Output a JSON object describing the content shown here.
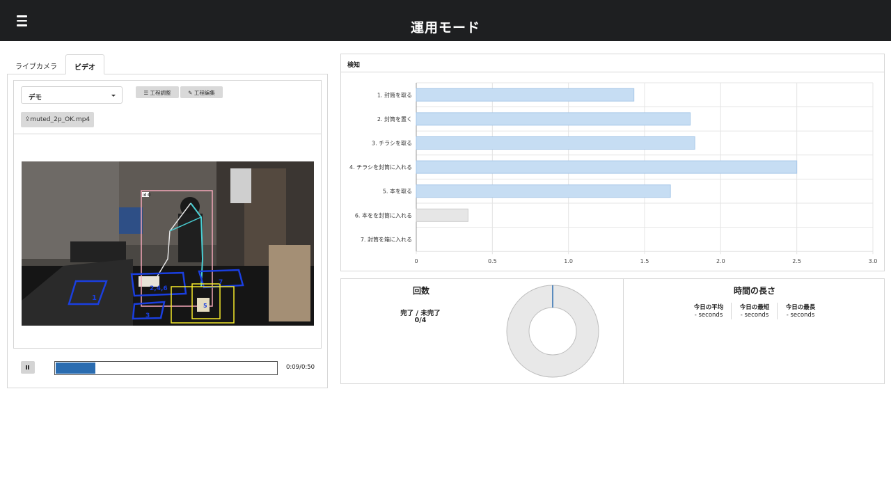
{
  "header": {
    "title": "運用モード",
    "menu_icon": "hamburger-menu-icon"
  },
  "tabs": [
    {
      "label": "ライブカメラ",
      "active": false
    },
    {
      "label": "ビデオ",
      "active": true
    }
  ],
  "video_panel": {
    "select_value": "デモ",
    "adjust_button": "工程調整",
    "edit_button": "工程編集",
    "file_button": "muted_2p_OK.mp4",
    "playback": {
      "time": "0:09/0:50",
      "progress": 0.18,
      "state": "playing"
    },
    "overlay_labels": [
      "id:0",
      "1",
      "2,4,6",
      "7",
      "3",
      "5"
    ]
  },
  "detection": {
    "title": "検知",
    "colors": {
      "bar_fill": "#c6ddf3",
      "bar_stroke": "#a7c7e8",
      "inactive_fill": "#e6e6e6",
      "inactive_stroke": "#cccccc"
    }
  },
  "chart_data": {
    "type": "bar",
    "orientation": "horizontal",
    "categories": [
      "1. 封筒を取る",
      "2. 封筒を置く",
      "3. チラシを取る",
      "4. チラシを封筒に入れる",
      "5. 本を取る",
      "6. 本をを封筒に入れる",
      "7. 封筒を箱に入れる"
    ],
    "values": [
      1.43,
      1.8,
      1.83,
      2.5,
      1.67,
      0.34,
      0
    ],
    "highlighted": [
      true,
      true,
      true,
      true,
      true,
      false,
      false
    ],
    "xlim": [
      0,
      3.0
    ],
    "xticks": [
      "0",
      "0.5",
      "1.0",
      "1.5",
      "2.0",
      "2.5",
      "3.0"
    ],
    "grid": true
  },
  "count": {
    "title": "回数",
    "label": "完了 / 未完了",
    "value": "0/4",
    "completed": 0,
    "total": 4,
    "colors": {
      "ring": "#e8e8e8",
      "ring_stroke": "#bdbdbd",
      "marker": "#2a6cb0"
    }
  },
  "duration": {
    "title": "時間の長さ",
    "stats": [
      {
        "label": "今日の平均",
        "value": "- seconds"
      },
      {
        "label": "今日の最短",
        "value": "- seconds"
      },
      {
        "label": "今日の最長",
        "value": "- seconds"
      }
    ]
  }
}
